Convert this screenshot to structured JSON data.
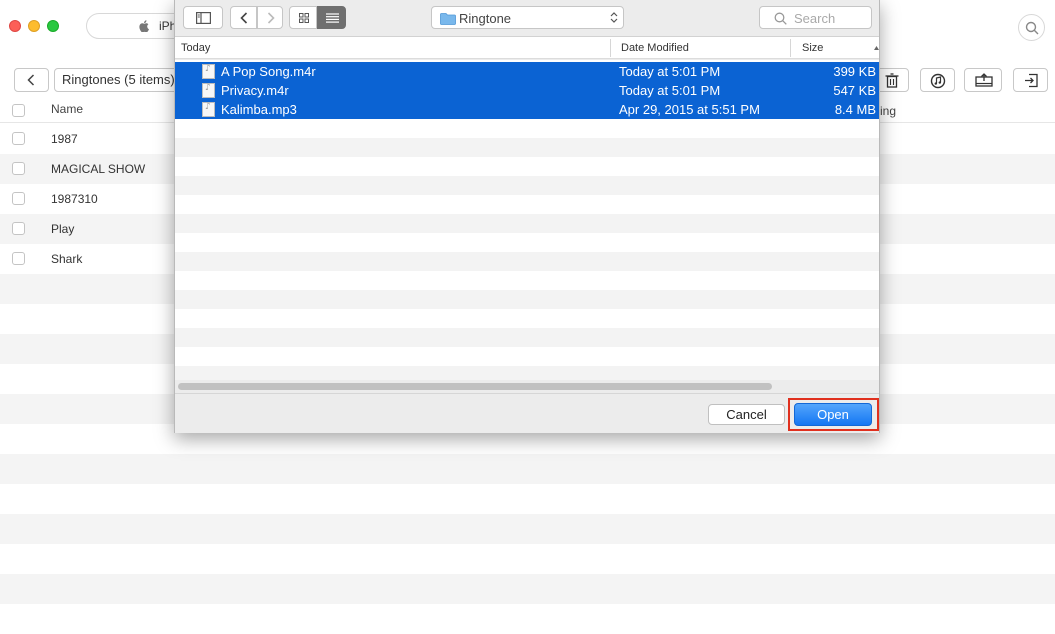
{
  "app": {
    "device_label": "iPh",
    "folder_label": "Ringtones (5 items)",
    "list_header": {
      "name": "Name",
      "ringtone_partial": "ing"
    },
    "items": [
      "1987",
      "MAGICAL SHOW",
      "1987310",
      "Play",
      "Shark"
    ]
  },
  "dialog": {
    "location": "Ringtone",
    "search_placeholder": "Search",
    "columns": {
      "name": "Today",
      "date": "Date Modified",
      "size": "Size"
    },
    "files": [
      {
        "name": "A Pop Song.m4r",
        "date": "Today at 5:01 PM",
        "size": "399 KB",
        "selected": true
      },
      {
        "name": "Privacy.m4r",
        "date": "Today at 5:01 PM",
        "size": "547 KB",
        "selected": true
      },
      {
        "name": "Kalimba.mp3",
        "date": "Apr 29, 2015 at 5:51 PM",
        "size": "8.4 MB",
        "selected": true
      }
    ],
    "cancel_label": "Cancel",
    "open_label": "Open"
  },
  "colors": {
    "selection": "#0b63d3",
    "open_button": "#1a82fb",
    "highlight_box": "#e0301e"
  }
}
